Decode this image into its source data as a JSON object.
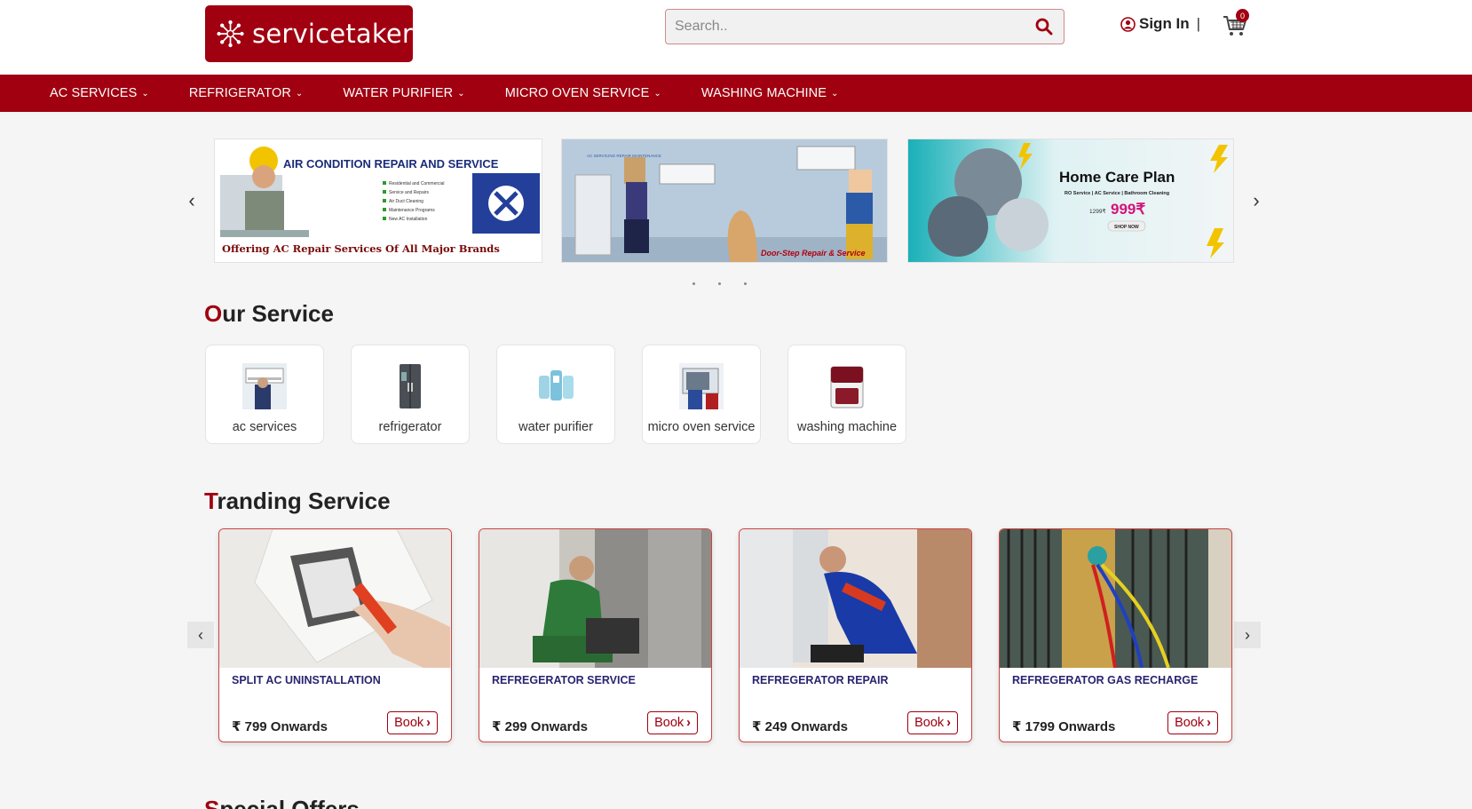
{
  "header": {
    "logo_text": "servicetaker",
    "search_placeholder": "Search..",
    "signin_label": "Sign In",
    "signin_separator": "|",
    "cart_count": "0"
  },
  "nav": {
    "items": [
      {
        "label": "AC SERVICES"
      },
      {
        "label": "REFRIGERATOR"
      },
      {
        "label": "WATER PURIFIER"
      },
      {
        "label": "MICRO OVEN SERVICE"
      },
      {
        "label": "WASHING MACHINE"
      }
    ]
  },
  "banners": {
    "b1": {
      "title": "AIR CONDITION REPAIR AND SERVICE",
      "bullets": [
        "Residential and Commercial",
        "Service and Repairs",
        "Air Duct Cleaning",
        "Maintenance Programs",
        "New AC Installation"
      ],
      "footer": "Offering AC Repair Services Of All Major Brands"
    },
    "b2": {
      "tag": "AC SERVICING REPAIR MAINTENANCE",
      "footer": "Door-Step Repair & Service"
    },
    "b3": {
      "title": "Home Care Plan",
      "subtitle": "RO Service | AC Service | Bathroom Cleaning",
      "old_price": "1299₹",
      "price": "999₹",
      "cta": "SHOP NOW"
    }
  },
  "our_service": {
    "title_first": "O",
    "title_rest": "ur Service",
    "items": [
      {
        "label": "ac services"
      },
      {
        "label": "refrigerator"
      },
      {
        "label": "water purifier"
      },
      {
        "label": "micro oven service"
      },
      {
        "label": "washing machine"
      }
    ]
  },
  "trending": {
    "title_first": "T",
    "title_rest": "randing Service",
    "items": [
      {
        "title": "SPLIT AC UNINSTALLATION",
        "price": "₹ 799 Onwards",
        "book": "Book"
      },
      {
        "title": "REFREGERATOR SERVICE",
        "price": "₹ 299 Onwards",
        "book": "Book"
      },
      {
        "title": "REFREGERATOR REPAIR",
        "price": "₹ 249 Onwards",
        "book": "Book"
      },
      {
        "title": "REFREGERATOR GAS RECHARGE",
        "price": "₹ 1799 Onwards",
        "book": "Book"
      }
    ]
  },
  "special_offers": {
    "title_first": "S",
    "title_rest": "pecial Offers"
  },
  "colors": {
    "brand": "#a00010",
    "title_text": "#2a2470"
  }
}
